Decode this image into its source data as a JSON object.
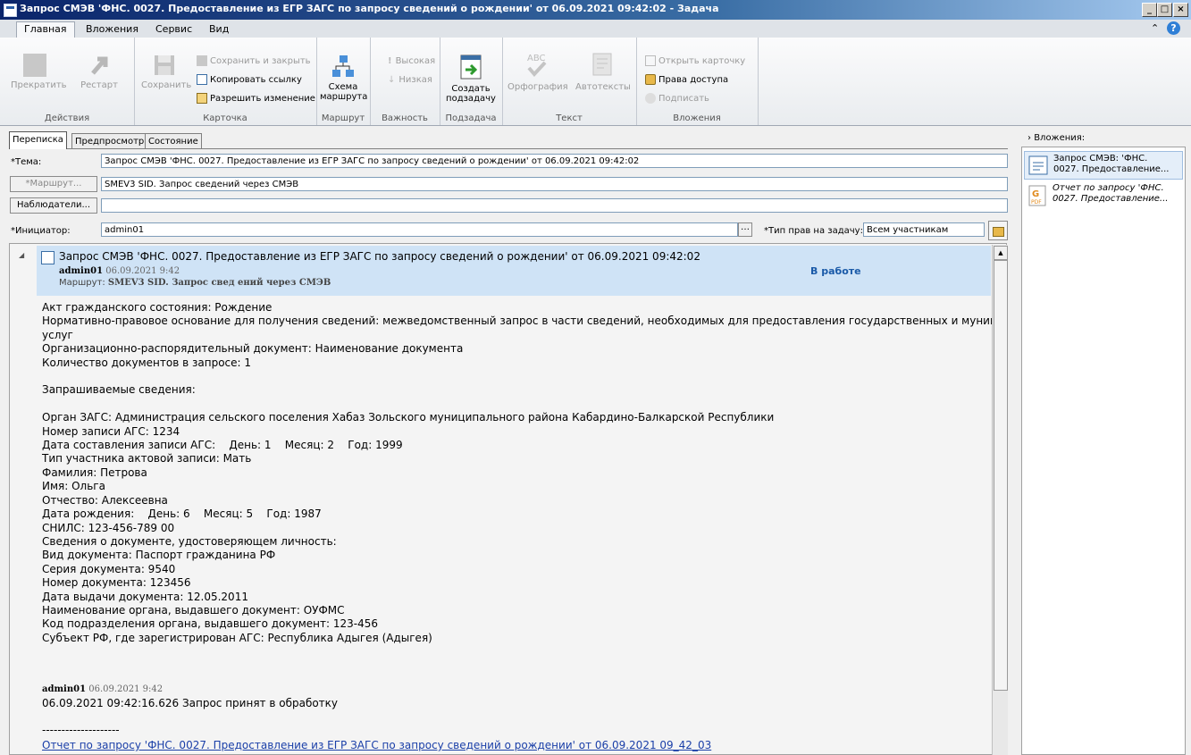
{
  "window": {
    "title": "Запрос СМЭВ 'ФНС. 0027. Предоставление из ЕГР ЗАГС по запросу сведений о рождении' от 06.09.2021 09:42:02 - Задача"
  },
  "ribbon_tabs": [
    "Главная",
    "Вложения",
    "Сервис",
    "Вид"
  ],
  "ribbon": {
    "actions": {
      "stop": "Прекратить",
      "restart": "Рестарт",
      "label": "Действия"
    },
    "card": {
      "save": "Сохранить",
      "save_close": "Сохранить и закрыть",
      "copy_link": "Копировать ссылку",
      "allow_change": "Разрешить изменение",
      "label": "Карточка"
    },
    "route": {
      "scheme_line1": "Схема",
      "scheme_line2": "маршрута",
      "label": "Маршрут"
    },
    "importance": {
      "high": "Высокая",
      "low": "Низкая",
      "label": "Важность"
    },
    "subtask": {
      "create_line1": "Создать",
      "create_line2": "подзадачу",
      "label": "Подзадача"
    },
    "text": {
      "spelling": "Орфография",
      "autotexts": "Автотексты",
      "label": "Текст"
    },
    "attachments": {
      "open_card": "Открыть карточку",
      "access": "Права доступа",
      "sign": "Подписать",
      "label": "Вложения"
    }
  },
  "tabs": [
    "Переписка",
    "Предпросмотр",
    "Состояние"
  ],
  "form": {
    "subject_label": "*Тема:",
    "subject_value": "Запрос СМЭВ 'ФНС. 0027. Предоставление из ЕГР ЗАГС по запросу сведений о рождении' от 06.09.2021 09:42:02",
    "route_button": "*Маршрут...",
    "route_value": "SMEV3 SID. Запрос сведений через СМЭВ",
    "observers_button": "Наблюдатели...",
    "initiator_label": "*Инициатор:",
    "initiator_value": "admin01",
    "rights_label": "*Тип прав на задачу:",
    "rights_value": "Всем участникам"
  },
  "message": {
    "title": "Запрос СМЭВ 'ФНС. 0027. Предоставление из ЕГР ЗАГС по запросу сведений о рождении' от 06.09.2021 09:42:02",
    "author": "admin01",
    "date": "06.09.2021 9:42",
    "route_label": "Маршрут:",
    "route_value": "SMEV3 SID. Запрос свед ений через СМЭВ",
    "status": "В работе",
    "body_lines": [
      "Акт гражданского состояния: Рождение",
      "Нормативно-правовое основание для получения сведений: межведомственный запрос в части сведений, необходимых для предоставления государственных и муниципальных",
      "услуг",
      "Организационно-распорядительный документ: Наименование документа",
      "Количество документов в запросе: 1",
      "",
      "Запрашиваемые сведения:",
      "",
      "Орган ЗАГС: Администрация сельского поселения Хабаз Зольского муниципального района Кабардино-Балкарской Республики",
      "Номер записи АГС: 1234",
      "Дата составления записи АГС:    День: 1    Месяц: 2    Год: 1999",
      "Тип участника актовой записи: Мать",
      "Фамилия: Петрова",
      "Имя: Ольга",
      "Отчество: Алексеевна",
      "Дата рождения:    День: 6    Месяц: 5    Год: 1987",
      "СНИЛС: 123-456-789 00",
      "Сведения о документе, удостоверяющем личность:",
      "Вид документа: Паспорт гражданина РФ",
      "Серия документа: 9540",
      "Номер документа: 123456",
      "Дата выдачи документа: 12.05.2011",
      "Наименование органа, выдавшего документ: ОУФМС",
      "Код подразделения органа, выдавшего документ: 123-456",
      "Субъект РФ, где зарегистрирован АГС: Республика Адыгея (Адыгея)"
    ],
    "reply_author": "admin01",
    "reply_date": "06.09.2021 9:42",
    "reply_text": "06.09.2021 09:42:16.626 Запрос принят в обработку",
    "separator": "--------------------",
    "link": "Отчет по запросу 'ФНС. 0027. Предоставление из ЕГР ЗАГС по запросу сведений о рождении' от 06.09.2021 09_42_03"
  },
  "attachments_pane": {
    "header": "Вложения:",
    "items": [
      {
        "text": "Запрос СМЭВ: 'ФНС.\n0027. Предоставление...",
        "icon": "document-icon"
      },
      {
        "text": "Отчет по запросу 'ФНС.\n0027. Предоставление...",
        "icon": "pdf-icon"
      }
    ]
  }
}
